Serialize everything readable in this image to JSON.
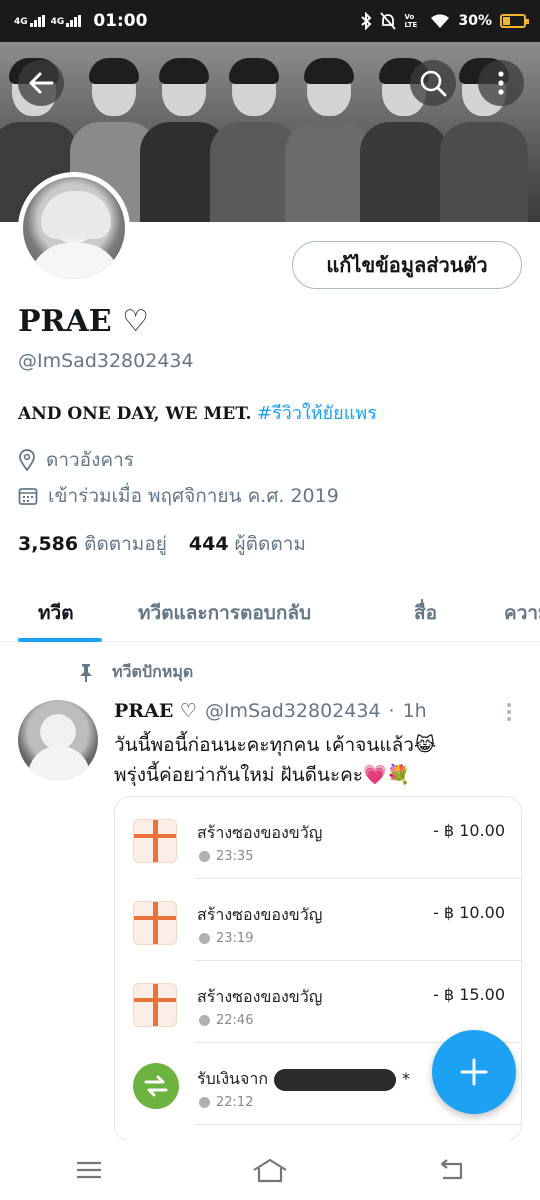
{
  "status_bar": {
    "network1": "4G",
    "network2": "4G",
    "time": "01:00",
    "volte": "Vo LTE",
    "battery": "30%",
    "battery_level": 0.3
  },
  "colors": {
    "accent": "#1da1f2",
    "secondary_text": "#657786",
    "gift_orange": "#e8743b",
    "receive_green": "#6cb33f"
  },
  "profile": {
    "edit_button": "แก้ไขข้อมูลส่วนตัว",
    "name": "PRAE ♡",
    "handle": "@ImSad32802434",
    "bio_text": "AND ONE DAY, WE MET.",
    "bio_hashtag": "#รีวิวให้ยัยแพร",
    "location": "ดาวอังคาร",
    "joined": "เข้าร่วมเมื่อ พฤศจิกายน ค.ศ. 2019",
    "following_count": "3,586",
    "following_label": "ติดตามอยู่",
    "followers_count": "444",
    "followers_label": "ผู้ติดตาม"
  },
  "tabs": [
    "ทวีต",
    "ทวีตและการตอบกลับ",
    "สื่อ",
    "ความ"
  ],
  "tweet": {
    "pinned_label": "ทวีตปักหมุด",
    "author_name": "PRAE ♡",
    "author_handle": "@ImSad32802434",
    "dot": "·",
    "time": "1h",
    "line1": "วันนี้พอนี้ก่อนนะคะทุกคน เค้าจนแล้ว😹",
    "line2": "พรุ่งนี้ค่อยว่ากันใหม่ ฝันดีนะคะ💗💐"
  },
  "transactions": [
    {
      "title": "สร้างซองของขวัญ",
      "time": "23:35",
      "amount": "- ฿ 10.00",
      "icon": "gift-icon"
    },
    {
      "title": "สร้างซองของขวัญ",
      "time": "23:19",
      "amount": "- ฿ 10.00",
      "icon": "gift-icon"
    },
    {
      "title": "สร้างซองของขวัญ",
      "time": "22:46",
      "amount": "- ฿ 15.00",
      "icon": "gift-icon"
    },
    {
      "title": "รับเงินจาก",
      "suffix": "*",
      "time": "22:12",
      "amount": "",
      "icon": "swap-icon"
    }
  ]
}
